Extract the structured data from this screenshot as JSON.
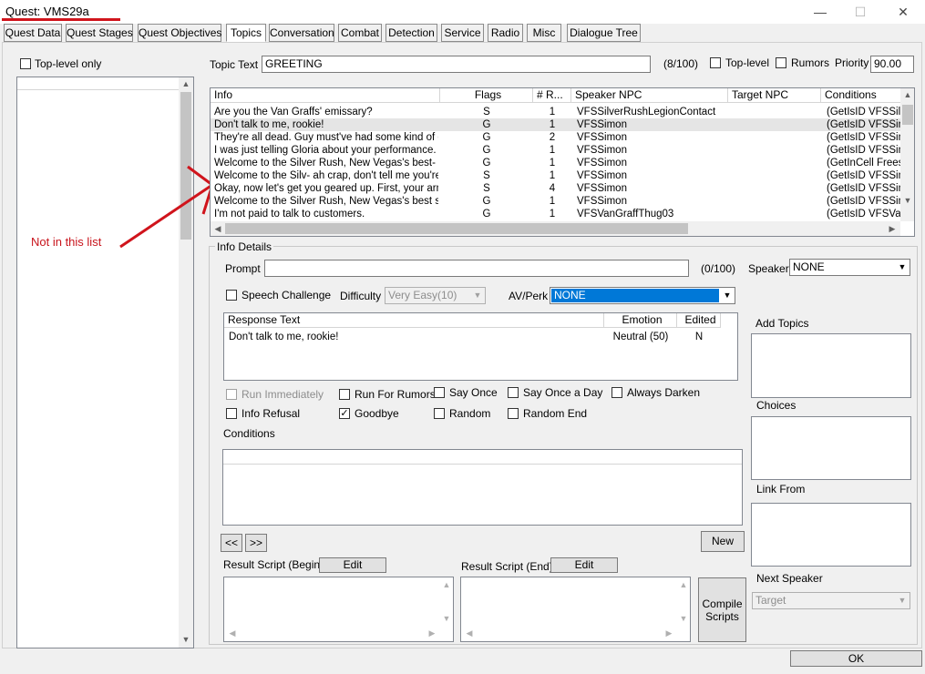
{
  "window": {
    "title": "Quest: VMS29a",
    "minimize": "—",
    "maximize": "☐",
    "close": "✕"
  },
  "tabs": [
    "Quest Data",
    "Quest Stages",
    "Quest Objectives",
    "Topics",
    "Conversation",
    "Combat",
    "Detection",
    "Service",
    "Radio",
    "Misc",
    "Dialogue Tree"
  ],
  "left": {
    "toplevel_only": "Top-level only"
  },
  "topic": {
    "label": "Topic Text",
    "value": "GREETING",
    "count": "(8/100)",
    "toplevel_label": "Top-level",
    "rumors_label": "Rumors",
    "priority_label": "Priority",
    "priority_value": "90.00"
  },
  "info_table": {
    "headers": [
      "Info",
      "Flags",
      "# R...",
      "Speaker NPC",
      "Target NPC",
      "Conditions"
    ],
    "rows": [
      {
        "info": "Are you the Van Graffs' emissary?",
        "flags": "S",
        "r": "1",
        "speaker": "VFSSilverRushLegionContact",
        "target": "",
        "cond": "(GetIsID VFSSilv"
      },
      {
        "info": "Don't talk to me, rookie!",
        "flags": "G",
        "r": "1",
        "speaker": "VFSSimon",
        "target": "",
        "cond": "(GetIsID VFSSim"
      },
      {
        "info": "They're all dead. Guy must've had some kind of e...",
        "flags": "G",
        "r": "2",
        "speaker": "VFSSimon",
        "target": "",
        "cond": "(GetIsID VFSSim"
      },
      {
        "info": "I was just telling Gloria about your performance. H...",
        "flags": "G",
        "r": "1",
        "speaker": "VFSSimon",
        "target": "",
        "cond": "(GetIsID VFSSim"
      },
      {
        "info": "Welcome to the Silver Rush, New Vegas's best- a...",
        "flags": "G",
        "r": "1",
        "speaker": "VFSSimon",
        "target": "",
        "cond": "(GetInCell Freesi"
      },
      {
        "info": "Welcome to the Silv- ah crap, don't tell me you're ...",
        "flags": "S",
        "r": "1",
        "speaker": "VFSSimon",
        "target": "",
        "cond": "(GetIsID VFSSim"
      },
      {
        "info": "Okay, now let's get you geared up. First, your arm...",
        "flags": "S",
        "r": "4",
        "speaker": "VFSSimon",
        "target": "",
        "cond": "(GetIsID VFSSim"
      },
      {
        "info": "Welcome to the Silver Rush, New Vegas's best s...",
        "flags": "G",
        "r": "1",
        "speaker": "VFSSimon",
        "target": "",
        "cond": "(GetIsID VFSSim"
      },
      {
        "info": "I'm not paid to talk to customers.",
        "flags": "G",
        "r": "1",
        "speaker": "VFSVanGraffThug03",
        "target": "",
        "cond": "(GetIsID VFSVar"
      }
    ]
  },
  "annotation": "Not in this list",
  "details": {
    "group_label": "Info Details",
    "prompt_label": "Prompt",
    "prompt_value": "",
    "prompt_count": "(0/100)",
    "speaker_label": "Speaker",
    "speaker_value": "NONE",
    "speech_challenge": "Speech Challenge",
    "difficulty_label": "Difficulty",
    "difficulty_value": "Very Easy(10)",
    "avperk_label": "AV/Perk",
    "avperk_value": "NONE",
    "response_headers": [
      "Response Text",
      "Emotion",
      "Edited"
    ],
    "responses": [
      {
        "text": "Don't talk to me, rookie!",
        "emotion": "Neutral (50)",
        "edited": "N"
      }
    ],
    "checks": {
      "run_immediately": "Run Immediately",
      "run_for_rumors": "Run For Rumors",
      "say_once": "Say Once",
      "say_once_a_day": "Say Once a Day",
      "always_darken": "Always Darken",
      "info_refusal": "Info Refusal",
      "goodbye": "Goodbye",
      "random": "Random",
      "random_end": "Random End"
    },
    "conditions_label": "Conditions",
    "prev": "<<",
    "next": ">>",
    "new": "New",
    "script_begin_label": "Result Script (Begin)",
    "script_end_label": "Result Script (End)",
    "edit": "Edit",
    "compile": "Compile Scripts"
  },
  "right": {
    "add_topics": "Add Topics",
    "choices": "Choices",
    "link_from": "Link From",
    "next_speaker": "Next Speaker",
    "target": "Target"
  },
  "ok": "OK"
}
